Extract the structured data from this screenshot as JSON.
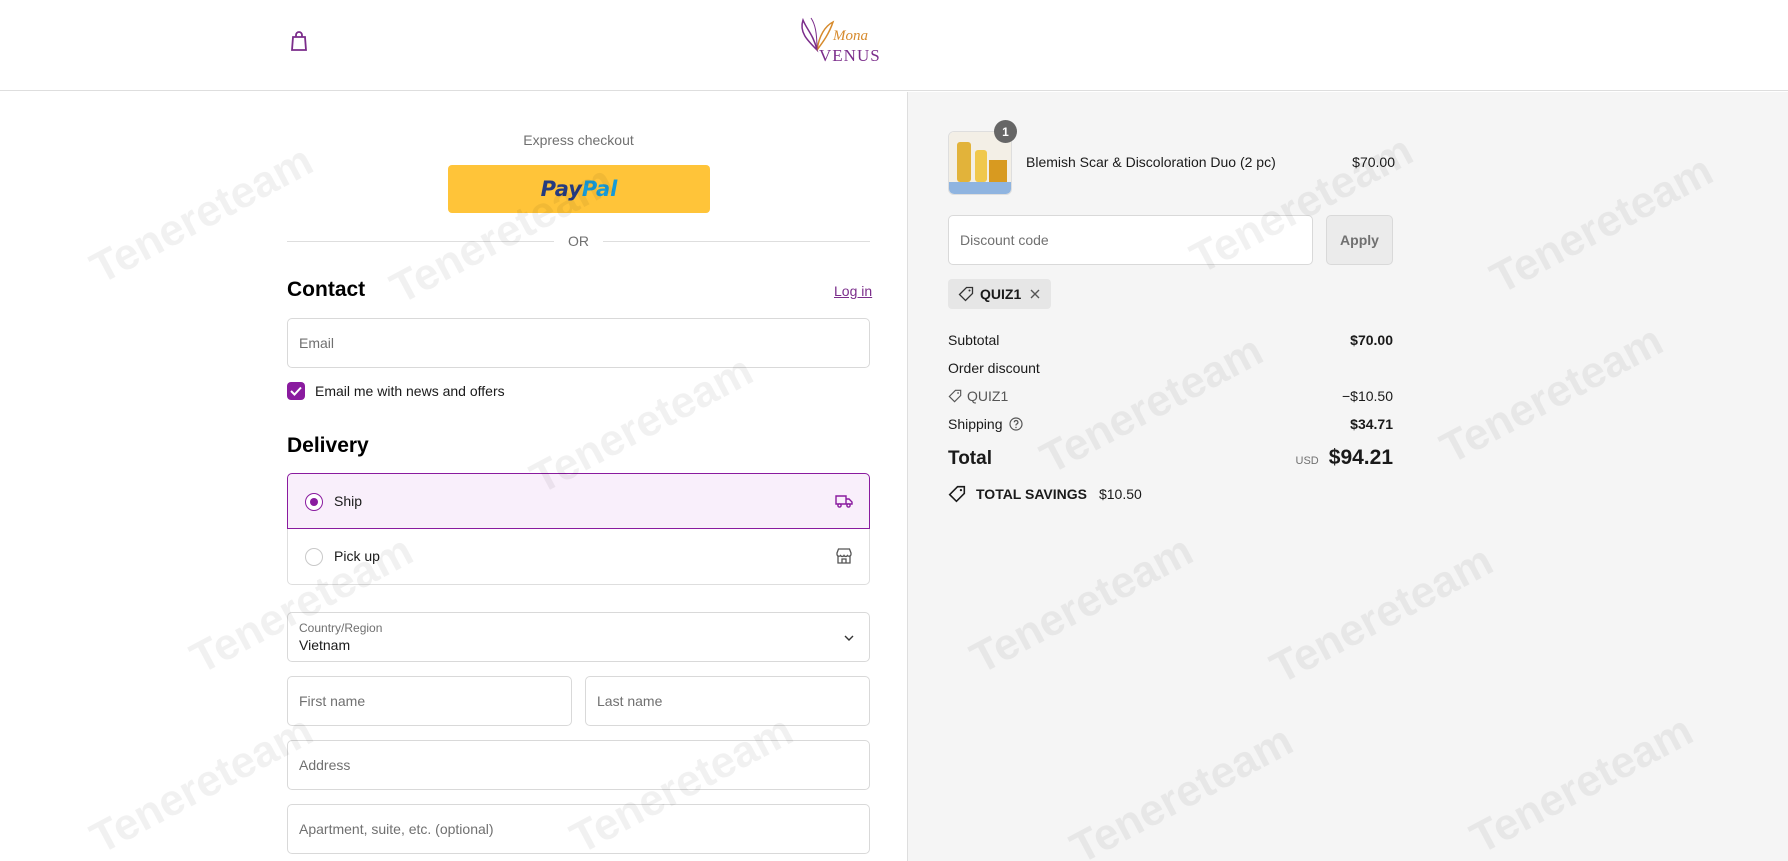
{
  "header": {
    "logo_top": "Mona",
    "logo_bottom": "VENUS"
  },
  "checkout": {
    "express_label": "Express checkout",
    "paypal_part1": "Pay",
    "paypal_part2": "Pal",
    "or_label": "OR",
    "contact_heading": "Contact",
    "login_link": "Log in",
    "email_placeholder": "Email",
    "newsletter_label": "Email me with news and offers",
    "newsletter_checked": true,
    "delivery_heading": "Delivery",
    "ship_label": "Ship",
    "pickup_label": "Pick up",
    "country_label": "Country/Region",
    "country_value": "Vietnam",
    "first_name_placeholder": "First name",
    "last_name_placeholder": "Last name",
    "address_placeholder": "Address",
    "apartment_placeholder": "Apartment, suite, etc. (optional)"
  },
  "summary": {
    "item_qty": "1",
    "item_name": "Blemish Scar & Discoloration Duo (2 pc)",
    "item_price": "$70.00",
    "discount_placeholder": "Discount code",
    "apply_label": "Apply",
    "applied_code": "QUIZ1",
    "subtotal_label": "Subtotal",
    "subtotal_value": "$70.00",
    "order_discount_label": "Order discount",
    "discount_code_label": "QUIZ1",
    "discount_value": "−$10.50",
    "shipping_label": "Shipping",
    "shipping_value": "$34.71",
    "total_label": "Total",
    "currency": "USD",
    "total_value": "$94.21",
    "savings_label": "TOTAL SAVINGS",
    "savings_value": "$10.50"
  },
  "watermark": "Tenereteam",
  "colors": {
    "accent": "#8a1b9f",
    "paypal_yellow": "#ffc439",
    "summary_bg": "#f5f5f5"
  }
}
